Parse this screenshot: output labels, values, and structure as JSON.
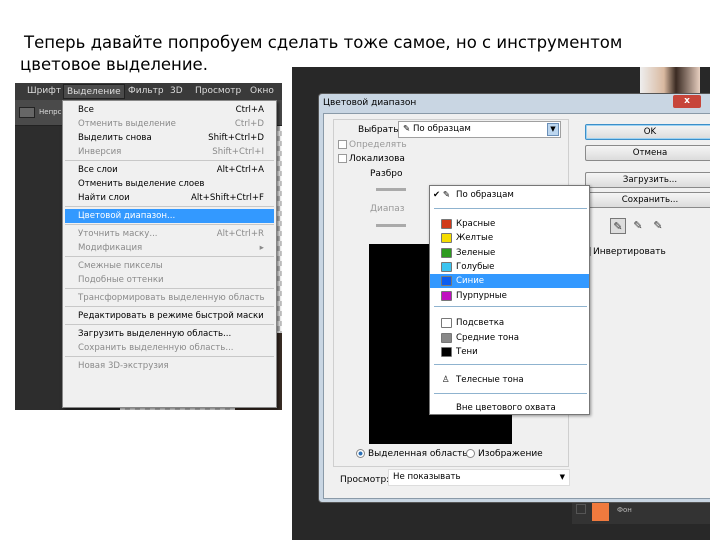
{
  "caption": "Теперь давайте попробуем сделать тоже самое, но с инструментом цветовое выделение.",
  "left_screenshot": {
    "menubar": [
      "Шрифт",
      "Выделение",
      "Фильтр",
      "3D",
      "Просмотр",
      "Окно"
    ],
    "options_text": "Непрс",
    "menu": [
      {
        "label": "Все",
        "shortcut": "Ctrl+A",
        "disabled": false
      },
      {
        "label": "Отменить выделение",
        "shortcut": "Ctrl+D",
        "disabled": true
      },
      {
        "label": "Выделить снова",
        "shortcut": "Shift+Ctrl+D",
        "disabled": false
      },
      {
        "label": "Инверсия",
        "shortcut": "Shift+Ctrl+I",
        "disabled": true
      },
      {
        "label": "Все слои",
        "shortcut": "Alt+Ctrl+A",
        "disabled": false
      },
      {
        "label": "Отменить выделение слоев",
        "shortcut": "",
        "disabled": false
      },
      {
        "label": "Найти слои",
        "shortcut": "Alt+Shift+Ctrl+F",
        "disabled": false
      },
      {
        "label": "Цветовой диапазон...",
        "shortcut": "",
        "highlighted": true
      },
      {
        "label": "Уточнить маску...",
        "shortcut": "Alt+Ctrl+R",
        "disabled": true
      },
      {
        "label": "Модификация",
        "shortcut": "▸",
        "disabled": true
      },
      {
        "label": "Смежные пикселы",
        "shortcut": "",
        "disabled": true
      },
      {
        "label": "Подобные оттенки",
        "shortcut": "",
        "disabled": true
      },
      {
        "label": "Трансформировать выделенную область",
        "shortcut": "",
        "disabled": true
      },
      {
        "label": "Редактировать в режиме быстрой маски",
        "shortcut": "",
        "disabled": false
      },
      {
        "label": "Загрузить выделенную область...",
        "shortcut": "",
        "disabled": false
      },
      {
        "label": "Сохранить выделенную область...",
        "shortcut": "",
        "disabled": true
      },
      {
        "label": "Новая 3D-экструзия",
        "shortcut": "",
        "disabled": true
      }
    ]
  },
  "dialog": {
    "title": "Цветовой диапазон",
    "close": "x",
    "select_label": "Выбрать:",
    "select_value": "По образцам",
    "checkbox_detect": "Определять",
    "checkbox_localized": "Локализова",
    "fuzziness_label": "Разбро",
    "range_label": "Диапаз",
    "dropdown": {
      "checked_item": "По образцам",
      "colors": [
        {
          "label": "Красные",
          "color": "#d03a1a"
        },
        {
          "label": "Желтые",
          "color": "#f5dc00"
        },
        {
          "label": "Зеленые",
          "color": "#2e9a20"
        },
        {
          "label": "Голубые",
          "color": "#3cc4f0"
        },
        {
          "label": "Синие",
          "color": "#0a5cf0",
          "highlighted": true
        },
        {
          "label": "Пурпурные",
          "color": "#c010c0"
        }
      ],
      "tones": [
        {
          "label": "Подсветка",
          "color": "#ffffff"
        },
        {
          "label": "Средние тона",
          "color": "#888888"
        },
        {
          "label": "Тени",
          "color": "#000000"
        }
      ],
      "skin": "Телесные тона",
      "out_of_gamut": "Вне цветового охвата"
    },
    "radio_selection": "Выделенная область",
    "radio_image": "Изображение",
    "preview_label": "Просмотр:",
    "preview_value": "Не показывать",
    "buttons": {
      "ok": "OK",
      "cancel": "Отмена",
      "load": "Загрузить...",
      "save": "Сохранить..."
    },
    "invert": "Инвертировать"
  },
  "layers": {
    "background_layer": "Фон"
  }
}
